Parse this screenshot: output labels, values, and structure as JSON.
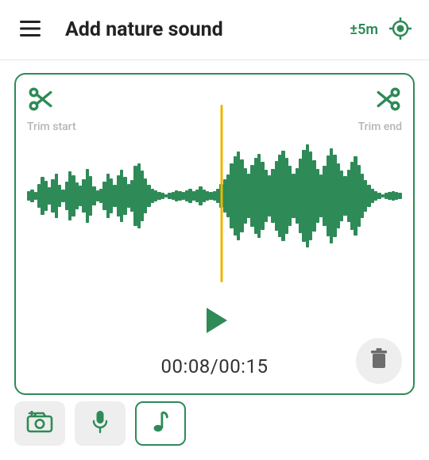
{
  "header": {
    "title": "Add nature sound",
    "accuracy": "±5m"
  },
  "audio": {
    "trim_start_label": "Trim start",
    "trim_end_label": "Trim end",
    "current_time": "00:08",
    "total_time": "00:15",
    "playhead_percent": 52,
    "waveform": [
      10,
      14,
      8,
      26,
      40,
      32,
      18,
      36,
      48,
      24,
      14,
      30,
      52,
      44,
      28,
      22,
      36,
      58,
      42,
      20,
      12,
      16,
      30,
      48,
      38,
      24,
      44,
      56,
      40,
      26,
      34,
      64,
      70,
      54,
      38,
      24,
      16,
      12,
      8,
      6,
      4,
      6,
      8,
      12,
      10,
      8,
      12,
      16,
      10,
      14,
      20,
      14,
      10,
      8,
      10,
      16,
      26,
      36,
      46,
      70,
      84,
      94,
      78,
      60,
      48,
      66,
      82,
      90,
      72,
      56,
      44,
      58,
      74,
      88,
      96,
      82,
      64,
      48,
      60,
      80,
      98,
      110,
      94,
      76,
      58,
      46,
      64,
      86,
      102,
      88,
      70,
      54,
      42,
      56,
      72,
      84,
      66,
      48,
      34,
      24,
      16,
      10,
      6,
      4,
      6,
      8,
      10,
      8,
      6
    ]
  },
  "icons": {
    "menu": "menu",
    "locate": "locate",
    "scissors_start": "scissors",
    "scissors_end": "scissors",
    "play": "play",
    "trash": "trash",
    "camera": "camera-add",
    "mic": "mic",
    "note": "music-note"
  },
  "colors": {
    "accent": "#2e8a57",
    "playhead": "#f0b400",
    "muted": "#999999"
  }
}
